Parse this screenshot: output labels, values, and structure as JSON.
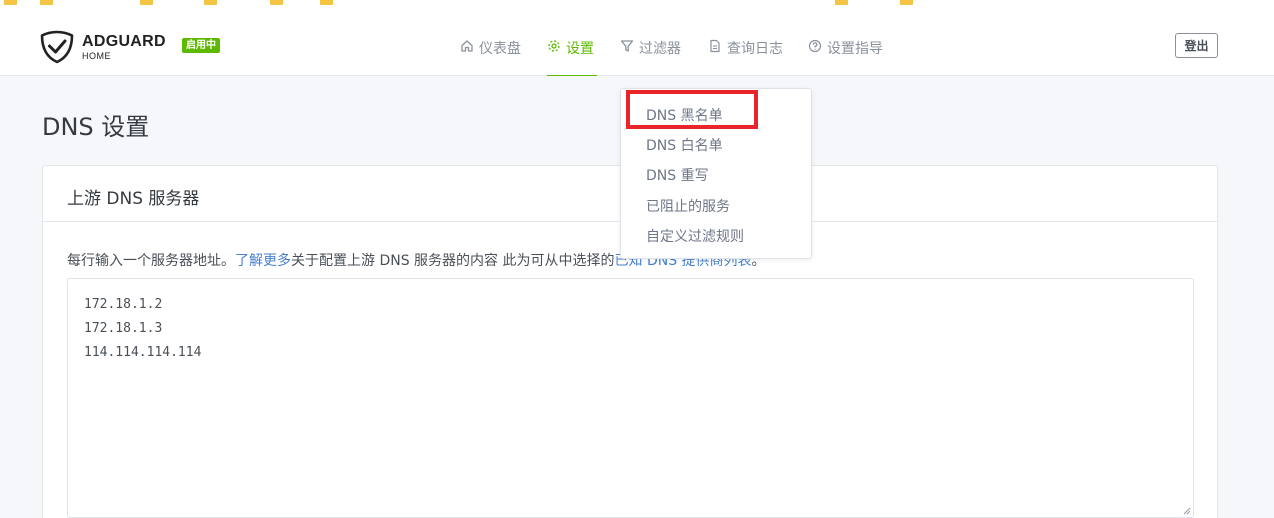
{
  "app": {
    "brand_main": "ADGUARD",
    "brand_sub": "HOME",
    "status_badge": "启用中",
    "brand_color": "#5eba00"
  },
  "nav": {
    "items": [
      {
        "label": "仪表盘",
        "icon": "home-icon"
      },
      {
        "label": "设置",
        "icon": "gear-icon",
        "active": true
      },
      {
        "label": "过滤器",
        "icon": "filter-icon"
      },
      {
        "label": "查询日志",
        "icon": "document-icon"
      },
      {
        "label": "设置指导",
        "icon": "help-circle-icon"
      }
    ],
    "logout_label": "登出"
  },
  "page": {
    "title": "DNS 设置"
  },
  "upstream": {
    "header": "上游 DNS 服务器",
    "desc_before": "每行输入一个服务器地址。",
    "desc_link": "了解更多",
    "desc_middle": "关于配置上游 DNS 服务器的内容 此为可从中选择的",
    "desc_link2": "已知 DNS 提供商列表",
    "desc_end": "。",
    "servers": [
      "172.18.1.2",
      "172.18.1.3",
      "114.114.114.114"
    ]
  },
  "filters_menu": {
    "items": [
      {
        "label": "DNS 黑名单",
        "highlighted": true
      },
      {
        "label": "DNS 白名单"
      },
      {
        "label": "DNS 重写"
      },
      {
        "label": "已阻止的服务"
      },
      {
        "label": "自定义过滤规则"
      }
    ],
    "highlight_color": "#e8252b"
  }
}
